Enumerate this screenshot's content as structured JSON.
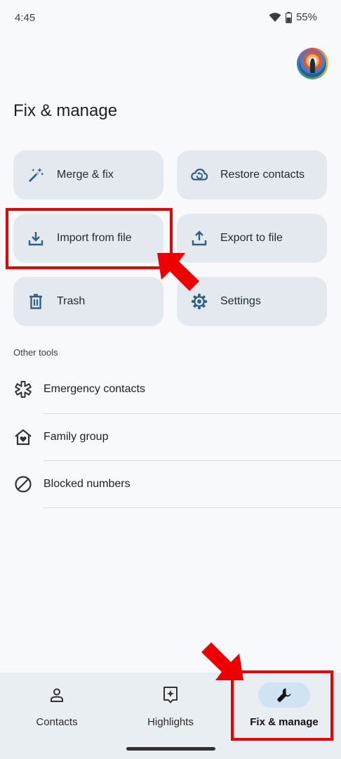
{
  "status_bar": {
    "time": "4:45",
    "battery": "55%"
  },
  "page": {
    "title": "Fix & manage"
  },
  "tiles": [
    {
      "label": "Merge & fix",
      "icon": "magic-wand-icon"
    },
    {
      "label": "Restore contacts",
      "icon": "cloud-restore-icon"
    },
    {
      "label": "Import from file",
      "icon": "download-icon"
    },
    {
      "label": "Export to file",
      "icon": "upload-icon"
    },
    {
      "label": "Trash",
      "icon": "trash-icon"
    },
    {
      "label": "Settings",
      "icon": "gear-icon"
    }
  ],
  "other_tools": {
    "heading": "Other tools",
    "items": [
      {
        "label": "Emergency contacts",
        "icon": "emergency-asterisk-icon"
      },
      {
        "label": "Family group",
        "icon": "family-home-icon"
      },
      {
        "label": "Blocked numbers",
        "icon": "block-icon"
      }
    ]
  },
  "bottom_nav": {
    "items": [
      {
        "label": "Contacts",
        "icon": "person-icon",
        "active": false
      },
      {
        "label": "Highlights",
        "icon": "highlights-icon",
        "active": false
      },
      {
        "label": "Fix & manage",
        "icon": "wrench-icon",
        "active": true
      }
    ]
  },
  "colors": {
    "annotation": "#ee0000",
    "tile_bg": "#e3e9ee",
    "accent_icon": "#2f5f86",
    "active_pill": "#cfe3f3"
  }
}
